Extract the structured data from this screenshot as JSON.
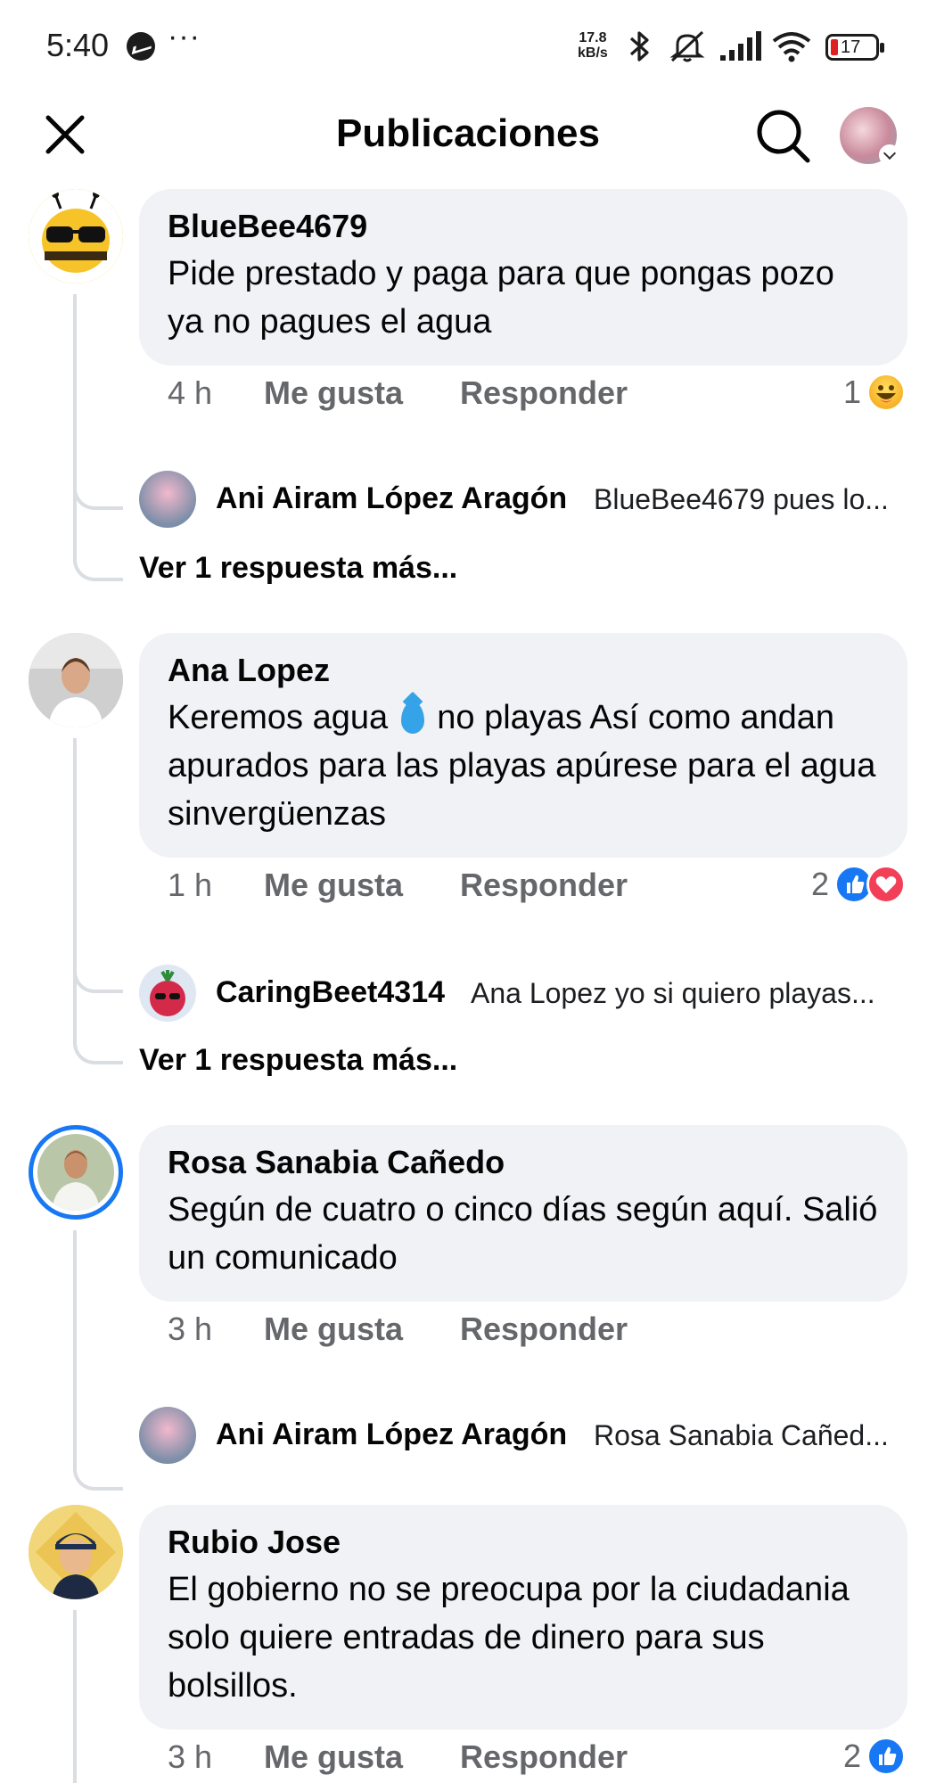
{
  "status_bar": {
    "time": "5:40",
    "more": "···",
    "speed_value": "17.8",
    "speed_unit": "kB/s",
    "battery": "17"
  },
  "header": {
    "title": "Publicaciones",
    "icons": [
      "close-icon",
      "search-icon",
      "profile-avatar"
    ]
  },
  "comments": [
    {
      "author": "BlueBee4679",
      "text": "Pide prestado y paga para que pongas pozo ya no pagues el agua",
      "time": "4 h",
      "like_label": "Me gusta",
      "reply_label": "Responder",
      "reaction_count": "1",
      "reactions": [
        "haha"
      ],
      "reply": {
        "author": "Ani Airam López Aragón",
        "text": "BlueBee4679 pues lo..."
      },
      "more_replies": "Ver 1 respuesta más..."
    },
    {
      "author": "Ana Lopez",
      "text_before": "Keremos agua",
      "text_after": "no playas Así como andan apurados para las playas apúrese para el agua sinvergüenzas",
      "time": "1 h",
      "like_label": "Me gusta",
      "reply_label": "Responder",
      "reaction_count": "2",
      "reactions": [
        "like",
        "love"
      ],
      "reply": {
        "author": "CaringBeet4314",
        "text": "Ana Lopez yo si quiero playas..."
      },
      "more_replies": "Ver 1 respuesta más..."
    },
    {
      "author": "Rosa Sanabia Cañedo",
      "text": "Según de cuatro o cinco días según aquí. Salió un comunicado",
      "time": "3 h",
      "like_label": "Me gusta",
      "reply_label": "Responder",
      "reply": {
        "author": "Ani Airam López Aragón",
        "text": "Rosa Sanabia Cañed..."
      }
    },
    {
      "author": "Rubio Jose",
      "text": "El gobierno no se preocupa por la ciudadania solo quiere entradas de dinero para sus bolsillos.",
      "time": "3 h",
      "like_label": "Me gusta",
      "reply_label": "Responder",
      "reaction_count": "2",
      "reactions": [
        "like"
      ]
    }
  ],
  "colors": {
    "bubble": "#f0f2f5",
    "meta_text": "#65676b",
    "like_blue": "#1877f2",
    "love_red": "#f33e58",
    "thread_line": "#dadde1"
  }
}
